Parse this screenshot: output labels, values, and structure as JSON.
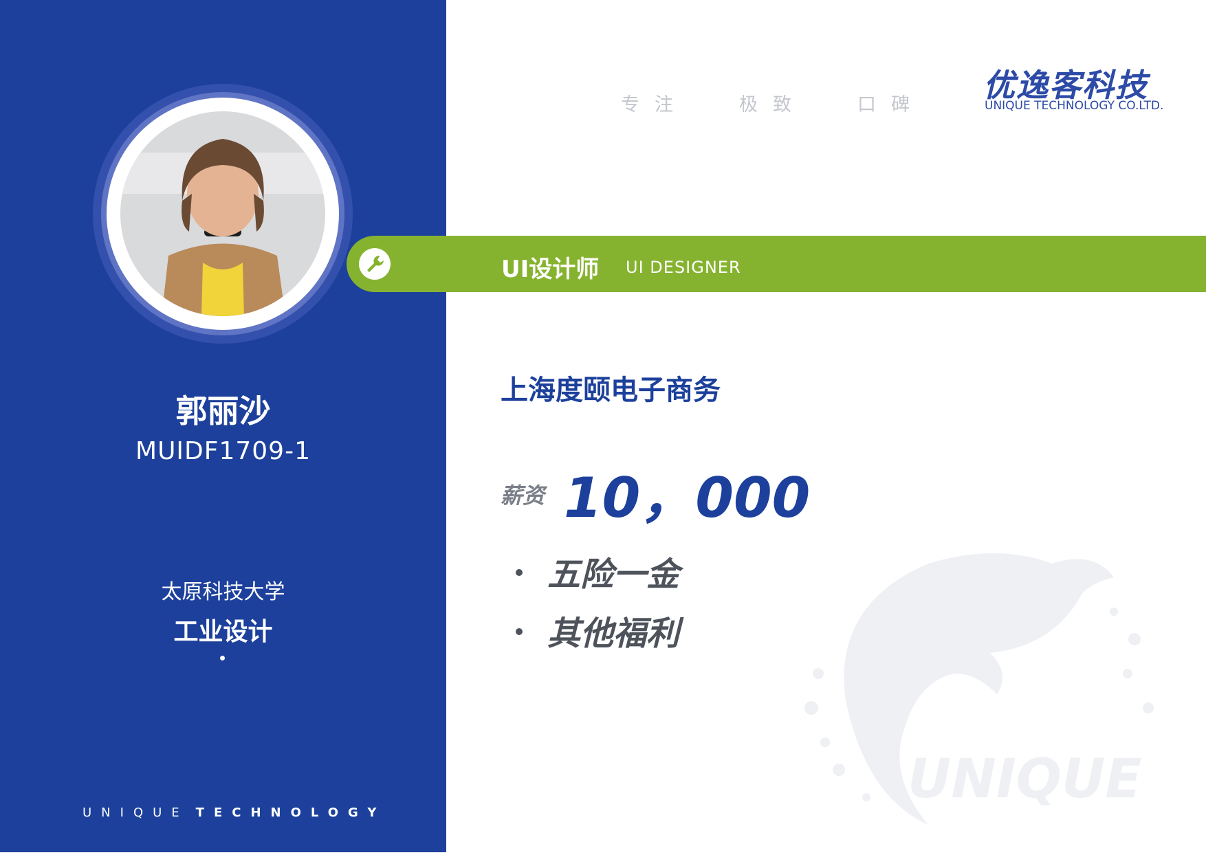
{
  "profile": {
    "name": "郭丽沙",
    "code": "MUIDF1709-1",
    "school": "太原科技大学",
    "major": "工业设计"
  },
  "footer": {
    "brand_light": "UNIQUE",
    "brand_bold": "TECHNOLOGY"
  },
  "slogans": [
    "专注",
    "极致",
    "口碑"
  ],
  "logo": {
    "cn": "优逸客科技",
    "en": "UNIQUE TECHNOLOGY CO.LTD."
  },
  "role": {
    "cn": "UI设计师",
    "en": "UI DESIGNER",
    "icon": "wrench-icon"
  },
  "job": {
    "company": "上海度颐电子商务",
    "salary_label": "薪资",
    "salary_value": "10，000",
    "benefits": [
      "五险一金",
      "其他福利"
    ]
  },
  "watermark": {
    "text": "UNIQUE"
  },
  "colors": {
    "brand_blue": "#1c409b",
    "accent_green": "#86b32f"
  }
}
